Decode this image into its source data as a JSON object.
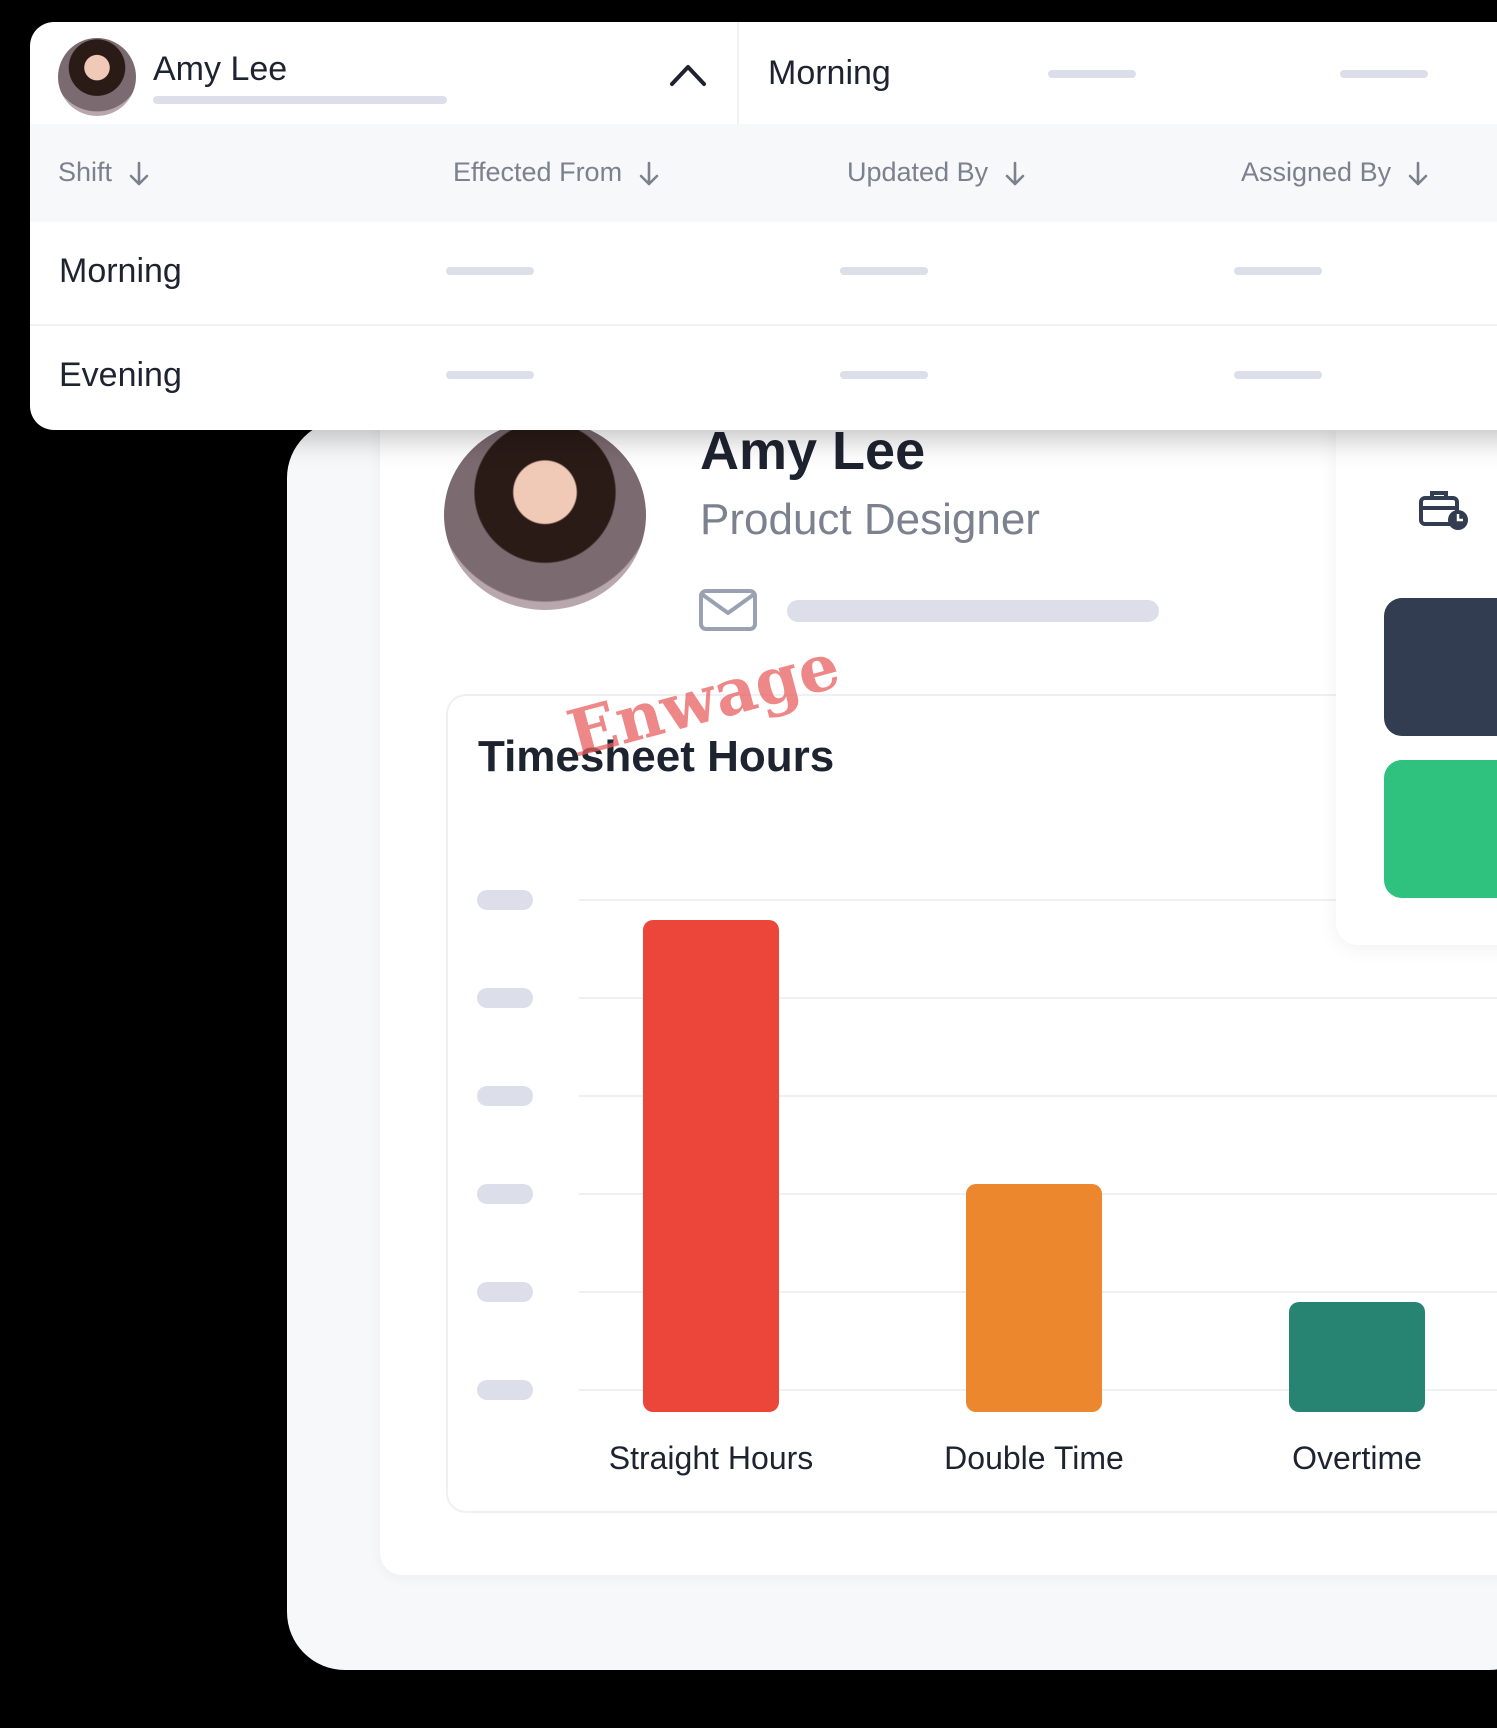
{
  "dropdown": {
    "user_name": "Amy Lee",
    "selected_shift": "Morning",
    "columns": [
      {
        "label": "Shift"
      },
      {
        "label": "Effected From"
      },
      {
        "label": "Updated By"
      },
      {
        "label": "Assigned By"
      }
    ],
    "rows": [
      {
        "shift": "Morning"
      },
      {
        "shift": "Evening"
      }
    ],
    "icons": [
      "chevron-up-icon",
      "arrow-down-icon"
    ]
  },
  "profile": {
    "name": "Amy Lee",
    "role": "Product Designer",
    "icons": [
      "mail-icon",
      "briefcase-clock-icon"
    ]
  },
  "watermark": "Enwage",
  "colors": {
    "straight": "#ec463b",
    "double": "#ec872e",
    "overtime": "#288472",
    "dark_card": "#333d51",
    "green_card": "#2ec27e"
  },
  "chart_data": {
    "type": "bar",
    "title": "Timesheet Hours",
    "categories": [
      "Straight Hours",
      "Double Time",
      "Overtime"
    ],
    "values": [
      4.8,
      2.1,
      0.9
    ],
    "ylim": [
      0,
      5
    ],
    "grid": true,
    "colors": [
      "#ec463b",
      "#ec872e",
      "#288472"
    ]
  }
}
